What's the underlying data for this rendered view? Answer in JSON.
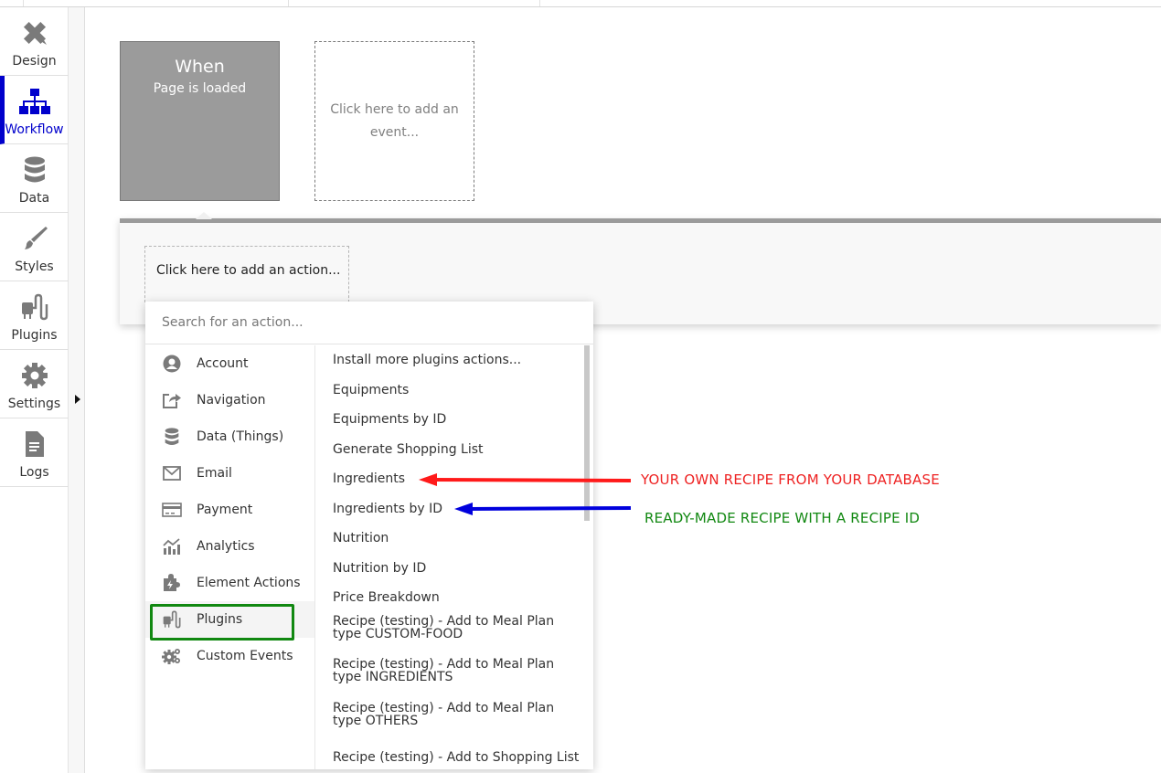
{
  "sidebar": {
    "items": [
      {
        "label": "Design",
        "icon": "design-icon",
        "active": false
      },
      {
        "label": "Workflow",
        "icon": "workflow-icon",
        "active": true
      },
      {
        "label": "Data",
        "icon": "database-icon",
        "active": false
      },
      {
        "label": "Styles",
        "icon": "brush-icon",
        "active": false
      },
      {
        "label": "Plugins",
        "icon": "plug-icon",
        "active": false
      },
      {
        "label": "Settings",
        "icon": "gear-icon",
        "active": false
      },
      {
        "label": "Logs",
        "icon": "document-icon",
        "active": false
      }
    ],
    "active_color": "#0000cc"
  },
  "events": {
    "current": {
      "title": "When",
      "trigger": "Page is loaded"
    },
    "add_event_label": "Click here to add an event..."
  },
  "actions": {
    "add_action_label": "Click here to add an action..."
  },
  "dropdown": {
    "search_placeholder": "Search for an action...",
    "categories": [
      {
        "label": "Account",
        "icon": "account-icon"
      },
      {
        "label": "Navigation",
        "icon": "navigation-icon"
      },
      {
        "label": "Data (Things)",
        "icon": "database-icon"
      },
      {
        "label": "Email",
        "icon": "envelope-icon"
      },
      {
        "label": "Payment",
        "icon": "credit-card-icon"
      },
      {
        "label": "Analytics",
        "icon": "analytics-icon"
      },
      {
        "label": "Element Actions",
        "icon": "puzzle-icon"
      },
      {
        "label": "Plugins",
        "icon": "plug-icon",
        "selected": true
      },
      {
        "label": "Custom Events",
        "icon": "gears-icon"
      }
    ],
    "actions": [
      {
        "line1": "Install more plugins actions..."
      },
      {
        "line1": "Equipments"
      },
      {
        "line1": "Equipments by ID"
      },
      {
        "line1": "Generate Shopping List"
      },
      {
        "line1": "Ingredients"
      },
      {
        "line1": "Ingredients by ID"
      },
      {
        "line1": "Nutrition"
      },
      {
        "line1": "Nutrition by ID"
      },
      {
        "line1": "Price Breakdown"
      },
      {
        "line1": "Recipe (testing) - Add to Meal Plan",
        "line2": "type CUSTOM-FOOD"
      },
      {
        "line1": "Recipe (testing) - Add to Meal Plan",
        "line2": "type INGREDIENTS"
      },
      {
        "line1": "Recipe (testing) - Add to Meal Plan",
        "line2": "type OTHERS"
      },
      {
        "line1": "Recipe (testing) - Add to Shopping List"
      }
    ],
    "highlight_color": "#118811"
  },
  "annotations": {
    "red": {
      "text": "YOUR OWN RECIPE FROM YOUR DATABASE",
      "color": "#ee2222",
      "points_to": "Ingredients"
    },
    "green": {
      "text": "READY-MADE RECIPE WITH A RECIPE ID",
      "color": "#118811",
      "points_to": "Ingredients by ID",
      "arrow_color": "#0000dd"
    }
  }
}
